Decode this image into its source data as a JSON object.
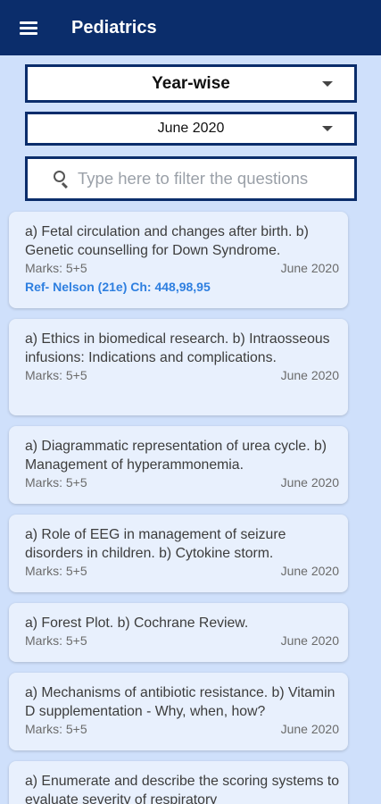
{
  "app": {
    "title": "Pediatrics"
  },
  "filters": {
    "year_select": "Year-wise",
    "month_select": "June 2020",
    "search_placeholder": "Type here to filter the questions"
  },
  "questions": [
    {
      "text": "a) Fetal circulation and changes after birth. b) Genetic counselling for Down Syndrome.",
      "marks": "Marks: 5+5",
      "date": "June 2020",
      "ref": "Ref- Nelson (21e) Ch: 448,98,95"
    },
    {
      "text": "a) Ethics in biomedical research. b) Intraosseous infusions: Indications and complications.",
      "marks": "Marks: 5+5",
      "date": "June 2020"
    },
    {
      "text": "a) Diagrammatic representation of urea cycle. b) Management of hyperammonemia.",
      "marks": "Marks: 5+5",
      "date": "June 2020"
    },
    {
      "text": "a) Role of EEG in management of seizure disorders in children. b) Cytokine storm.",
      "marks": "Marks: 5+5",
      "date": "June 2020"
    },
    {
      "text": "a) Forest Plot. b) Cochrane Review.",
      "marks": "Marks: 5+5",
      "date": "June 2020"
    },
    {
      "text": "a) Mechanisms of antibiotic resistance. b) Vitamin D supplementation - Why, when, how?",
      "marks": "Marks: 5+5",
      "date": "June 2020"
    },
    {
      "text": "a) Enumerate and describe the scoring systems to evaluate severity of respiratory"
    }
  ],
  "colors": {
    "appbar": "#0b2d6b",
    "background": "#cfe0fb",
    "card": "#e8f0fd",
    "ref_link": "#2e7fe0"
  }
}
